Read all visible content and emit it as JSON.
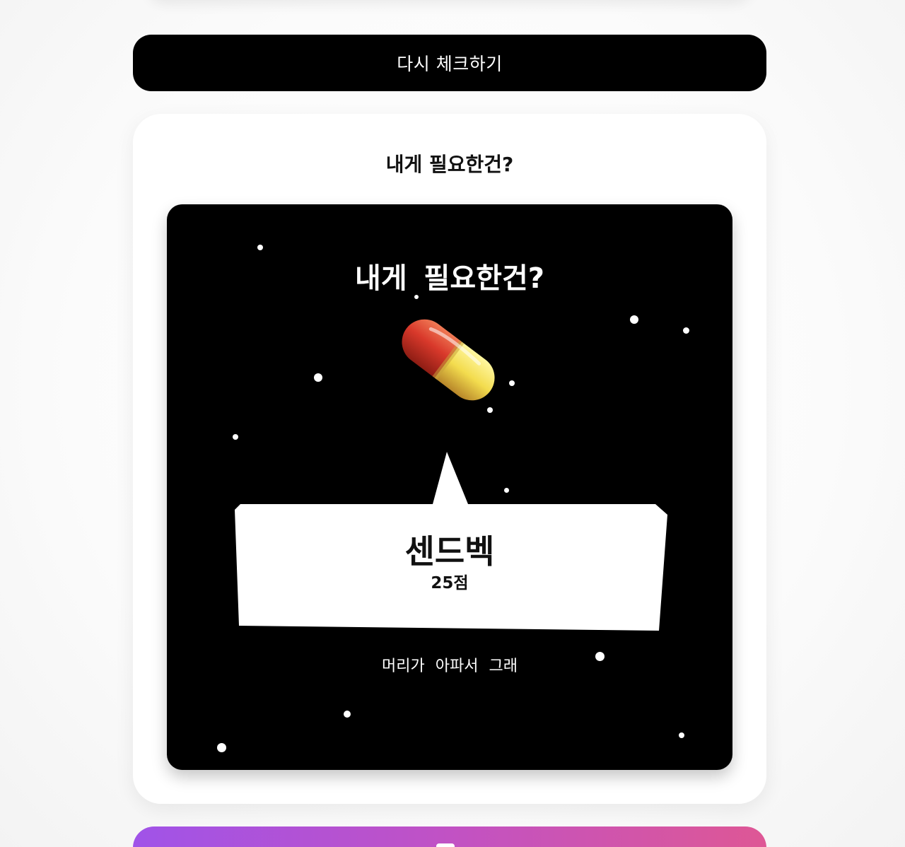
{
  "recheck_button": {
    "label": "다시 체크하기"
  },
  "result_card": {
    "title": "내게 필요한건?",
    "image": {
      "title": "내게 필요한건?",
      "icon": "pill-icon",
      "result_name": "센드벡",
      "score": "25점",
      "caption": "머리가 아파서 그래"
    }
  },
  "share_button": {
    "label": "",
    "icon": "share-icon"
  },
  "colors": {
    "button_dark": "#000000",
    "gradient_start": "#a053e8",
    "gradient_end": "#de5795",
    "pill_red": "#d9392b",
    "pill_yellow": "#f3dc4e"
  }
}
